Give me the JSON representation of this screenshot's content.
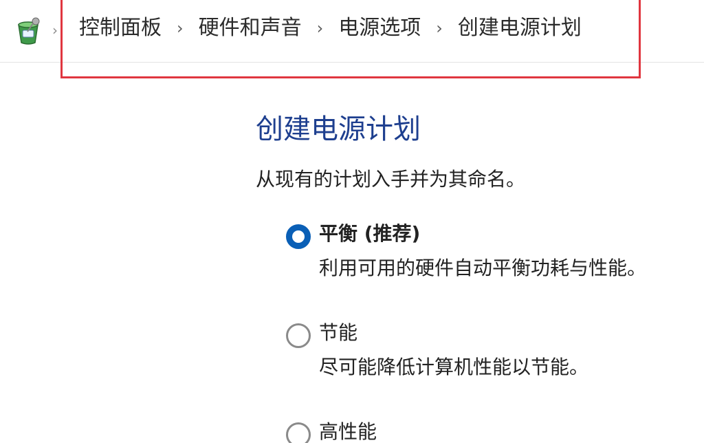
{
  "window": {
    "icon": "control-panel-icon"
  },
  "breadcrumb": {
    "items": [
      "控制面板",
      "硬件和声音",
      "电源选项",
      "创建电源计划"
    ],
    "separator": "›",
    "highlight_color": "#e0363f"
  },
  "main": {
    "title": "创建电源计划",
    "description": "从现有的计划入手并为其命名。",
    "title_color": "#1e3f8f"
  },
  "plans": [
    {
      "name": "平衡 (推荐)",
      "description": "利用可用的硬件自动平衡功耗与性能。",
      "selected": true
    },
    {
      "name": "节能",
      "description": "尽可能降低计算机性能以节能。",
      "selected": false
    },
    {
      "name": "高性能",
      "description": "",
      "selected": false
    }
  ],
  "colors": {
    "radio_selected": "#0a5fb6",
    "radio_unselected": "#8a8a8a"
  }
}
